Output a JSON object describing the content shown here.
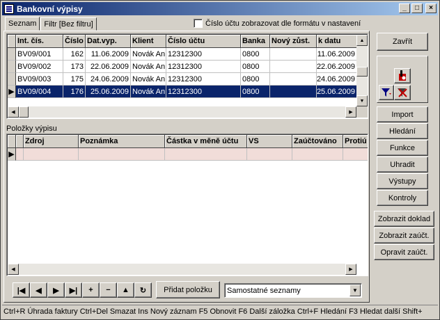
{
  "window": {
    "title": "Bankovní výpisy",
    "buttons": {
      "minimize": "_",
      "maximize": "□",
      "close": "×"
    }
  },
  "tabs": [
    {
      "label": "Seznam"
    },
    {
      "label": "Filtr [Bez filtru]"
    }
  ],
  "account_format_checkbox": {
    "label": "Číslo účtu zobrazovat dle formátu v nastavení",
    "checked": false
  },
  "statements_grid": {
    "columns": [
      "Int. čís.",
      "Číslo",
      "Dat.vyp.",
      "Klient",
      "Číslo účtu",
      "Banka",
      "Nový zůst.",
      "k datu"
    ],
    "rows": [
      [
        "BV09/001",
        "162",
        "11.06.2009",
        "Novák An",
        "12312300",
        "0800",
        "",
        "11.06.2009"
      ],
      [
        "BV09/002",
        "173",
        "22.06.2009",
        "Novák An",
        "12312300",
        "0800",
        "",
        "22.06.2009"
      ],
      [
        "BV09/003",
        "175",
        "24.06.2009",
        "Novák An",
        "12312300",
        "0800",
        "",
        "24.06.2009"
      ],
      [
        "BV09/004",
        "176",
        "25.06.2009",
        "Novák An",
        "12312300",
        "0800",
        "",
        "25.06.2009"
      ]
    ],
    "selected_row": 3
  },
  "items_label": "Položky výpisu",
  "items_grid": {
    "columns": [
      "Zdroj",
      "Poznámka",
      "Částka v měně účtu",
      "VS",
      "Zaúčtováno",
      "Protiú"
    ]
  },
  "right_buttons": {
    "close": "Zavřít",
    "import": "Import",
    "search": "Hledání",
    "functions": "Funkce",
    "pay": "Uhradit",
    "outputs": "Výstupy",
    "checks": "Kontroly",
    "show_document": "Zobrazit doklad",
    "show_posting": "Zobrazit zaúčt.",
    "fix_posting": "Opravit zaúčt."
  },
  "navigator": {
    "first": "|◀",
    "prev": "◀",
    "next": "▶",
    "last": "▶|",
    "add": "+",
    "delete": "−",
    "up": "▲",
    "refresh": "↻"
  },
  "add_item_button": "Přidat položku",
  "list_mode_combo": {
    "value": "Samostatné seznamy"
  },
  "status_bar": "Ctrl+R Úhrada faktury   Ctrl+Del Smazat   Ins Nový záznam   F5 Obnovit   F6 Další záložka   Ctrl+F Hledání   F3 Hledat další   Shift+"
}
